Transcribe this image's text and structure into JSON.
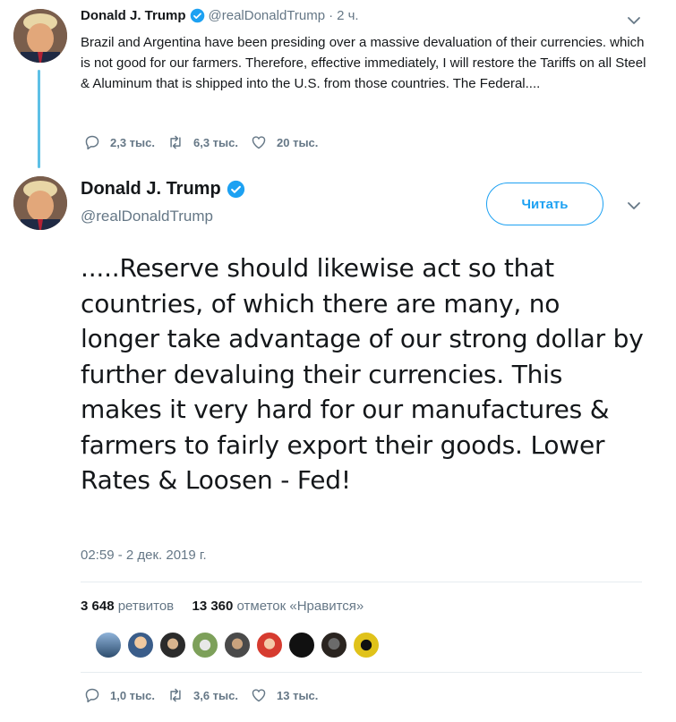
{
  "tweet1": {
    "name": "Donald J. Trump",
    "handle": "@realDonaldTrump",
    "separator": "·",
    "time": "2 ч.",
    "text": "Brazil and Argentina have been presiding over a massive devaluation of their currencies. which is not good for our farmers. Therefore, effective immediately, I will restore the Tariffs on all Steel & Aluminum that is shipped into the U.S. from those countries. The Federal....",
    "replies": "2,3 тыс.",
    "retweets": "6,3 тыс.",
    "likes": "20 тыс."
  },
  "tweet2": {
    "name": "Donald J. Trump",
    "handle": "@realDonaldTrump",
    "follow_label": "Читать",
    "text": ".....Reserve should likewise act so that countries, of which there are many, no longer take advantage of our strong dollar by further devaluing their currencies. This makes it very hard for our manufactures & farmers to fairly export their goods. Lower Rates & Loosen - Fed!",
    "timestamp": "02:59 - 2 дек. 2019 г.",
    "retweet_count": "3 648",
    "retweet_label": "ретвитов",
    "like_count": "13 360",
    "like_label": "отметок «Нравится»",
    "replies": "1,0 тыс.",
    "retweets": "3,6 тыс.",
    "likes": "13 тыс."
  },
  "colors": {
    "accent": "#1da1f2",
    "secondary_text": "#657786",
    "thread_line": "#5ec0e6"
  },
  "icons": [
    "verified-badge-icon",
    "chevron-down-icon",
    "reply-icon",
    "retweet-icon",
    "like-icon"
  ]
}
